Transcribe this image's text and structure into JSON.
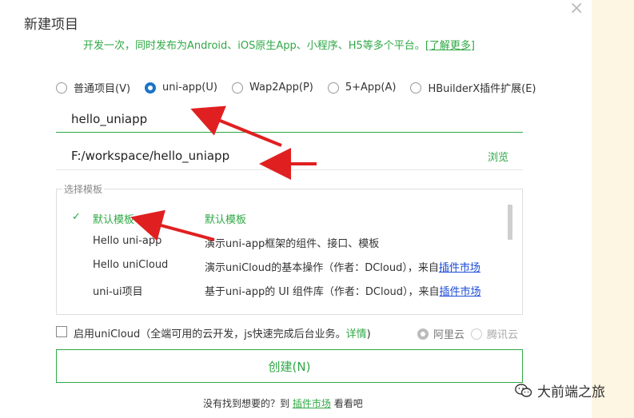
{
  "dialog": {
    "title": "新建项目",
    "close_glyph": "×",
    "subtitle": "开发一次，同时发布为Android、iOS原生App、小程序、H5等多个平台。",
    "learn_more": "[了解更多]"
  },
  "project_types": [
    {
      "label": "普通项目(V)",
      "checked": false
    },
    {
      "label": "uni-app(U)",
      "checked": true
    },
    {
      "label": "Wap2App(P)",
      "checked": false
    },
    {
      "label": "5+App(A)",
      "checked": false
    },
    {
      "label": "HBuilderX插件扩展(E)",
      "checked": false
    }
  ],
  "project_name": {
    "value": "hello_uniapp"
  },
  "project_path": {
    "value": "F:/workspace/hello_uniapp",
    "browse_label": "浏览"
  },
  "templates": {
    "legend": "选择模板",
    "check_glyph": "✓",
    "items": [
      {
        "name": "默认模板",
        "desc": "默认模板",
        "link": "",
        "selected": true
      },
      {
        "name": "Hello uni-app",
        "desc": "演示uni-app框架的组件、接口、模板",
        "link": "",
        "selected": false
      },
      {
        "name": "Hello uniCloud",
        "desc": "演示uniCloud的基本操作（作者：DCloud），来自",
        "link": "插件市场",
        "selected": false
      },
      {
        "name": "uni-ui项目",
        "desc": "基于uni-app的 UI 组件库（作者：DCloud），来自",
        "link": "插件市场",
        "selected": false
      }
    ]
  },
  "unicloud": {
    "label": "启用uniCloud（全端可用的云开发，js快速完成后台业务。",
    "details_link": "详情",
    "close_paren": ")",
    "providers": [
      {
        "label": "阿里云",
        "checked": true
      },
      {
        "label": "腾讯云",
        "checked": false
      }
    ]
  },
  "create_button": "创建(N)",
  "footer": {
    "prefix": "没有找到想要的？到",
    "link": "插件市场",
    "suffix": "看看吧"
  },
  "watermark": {
    "text": "大前端之旅",
    "icon": "wechat-icon"
  },
  "colors": {
    "accent_green": "#2fa845",
    "radio_blue": "#1a73c8",
    "arrow_red": "#e02020",
    "link_blue": "#1a4bd6"
  }
}
